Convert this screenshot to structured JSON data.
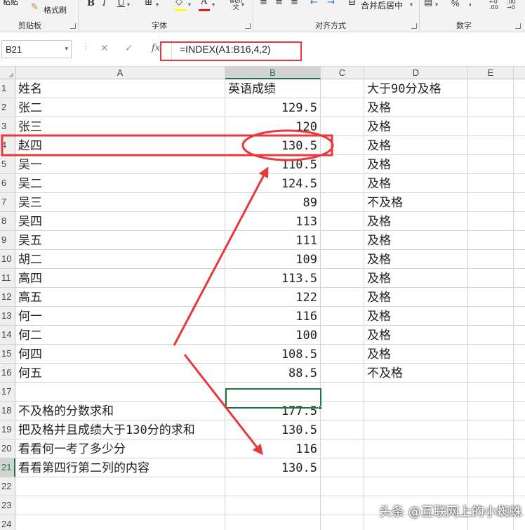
{
  "ribbon": {
    "paste_label": "粘贴",
    "format_painter_label": "格式刷",
    "groups": {
      "clipboard": "剪贴板",
      "font": "字体",
      "alignment": "对齐方式",
      "number": "数字"
    },
    "bold": "B",
    "italic": "I",
    "underline": "U",
    "merge_center_label": "合并后居中",
    "percent": "%",
    "comma": ",",
    "wen_label": "wén\n文"
  },
  "formula_bar": {
    "name_box": "B21",
    "fx": "fx",
    "formula": "=INDEX(A1:B16,4,2)"
  },
  "columns": [
    {
      "key": "A",
      "label": "A"
    },
    {
      "key": "B",
      "label": "B"
    },
    {
      "key": "C",
      "label": "C"
    },
    {
      "key": "D",
      "label": "D"
    },
    {
      "key": "E",
      "label": "E"
    }
  ],
  "rows": [
    {
      "num": "1",
      "a": "姓名",
      "b": "英语成绩",
      "d": "大于90分及格"
    },
    {
      "num": "2",
      "a": "张二",
      "b": "129.5",
      "d": "及格"
    },
    {
      "num": "3",
      "a": "张三",
      "b": "120",
      "d": "及格"
    },
    {
      "num": "4",
      "a": "赵四",
      "b": "130.5",
      "d": "及格"
    },
    {
      "num": "5",
      "a": "吴一",
      "b": "110.5",
      "d": "及格"
    },
    {
      "num": "6",
      "a": "吴二",
      "b": "124.5",
      "d": "及格"
    },
    {
      "num": "7",
      "a": "吴三",
      "b": "89",
      "d": "不及格"
    },
    {
      "num": "8",
      "a": "吴四",
      "b": "113",
      "d": "及格"
    },
    {
      "num": "9",
      "a": "吴五",
      "b": "111",
      "d": "及格"
    },
    {
      "num": "10",
      "a": "胡二",
      "b": "109",
      "d": "及格"
    },
    {
      "num": "11",
      "a": "高四",
      "b": "113.5",
      "d": "及格"
    },
    {
      "num": "12",
      "a": "高五",
      "b": "122",
      "d": "及格"
    },
    {
      "num": "13",
      "a": "何一",
      "b": "116",
      "d": "及格"
    },
    {
      "num": "14",
      "a": "何二",
      "b": "100",
      "d": "及格"
    },
    {
      "num": "15",
      "a": "何四",
      "b": "108.5",
      "d": "及格"
    },
    {
      "num": "16",
      "a": "何五",
      "b": "88.5",
      "d": "不及格"
    },
    {
      "num": "17",
      "a": "",
      "b": "",
      "d": ""
    },
    {
      "num": "18",
      "a": "不及格的分数求和",
      "b": "177.5",
      "d": ""
    },
    {
      "num": "19",
      "a": "把及格并且成绩大于130分的求和",
      "b": "130.5",
      "d": ""
    },
    {
      "num": "20",
      "a": "看看何一考了多少分",
      "b": "116",
      "d": ""
    },
    {
      "num": "21",
      "a": "看看第四行第二列的内容",
      "b": "130.5",
      "d": ""
    },
    {
      "num": "22",
      "a": "",
      "b": "",
      "d": ""
    },
    {
      "num": "23",
      "a": "",
      "b": "",
      "d": ""
    },
    {
      "num": "24",
      "a": "",
      "b": "",
      "d": ""
    }
  ],
  "selected_cell": "B21",
  "colors": {
    "annotation_red": "#e8383d",
    "excel_green": "#217346"
  },
  "watermark": "头条 @互联网上的小蜘蛛"
}
